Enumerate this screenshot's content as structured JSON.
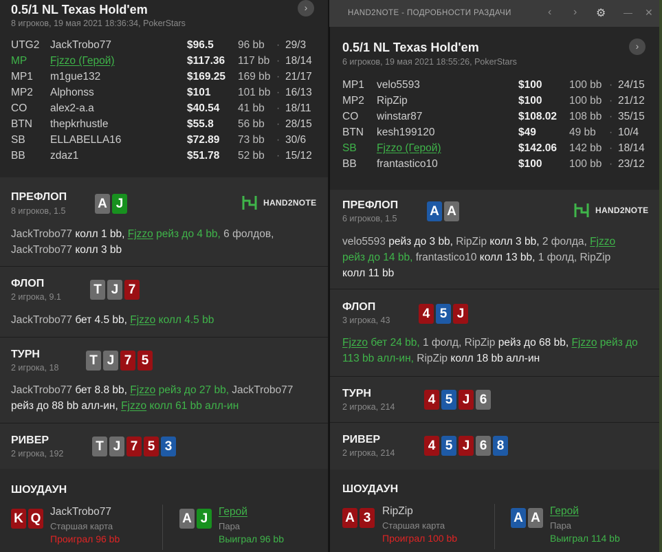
{
  "left": {
    "header": {
      "title": "0.5/1 NL Texas Hold'em",
      "subtitle": "8 игроков, 19 мая 2021 18:36:34, PokerStars",
      "nav": "›"
    },
    "players": [
      {
        "pos": "UTG2",
        "name": "JackTrobo77",
        "money": "$96.5",
        "bb": "96 bb",
        "dot": "·",
        "vpip": "29/3",
        "hero": false
      },
      {
        "pos": "MP",
        "name": "Fjzzo (Герой)",
        "money": "$117.36",
        "bb": "117 bb",
        "dot": "·",
        "vpip": "18/14",
        "hero": true
      },
      {
        "pos": "MP1",
        "name": "m1gue132",
        "money": "$169.25",
        "bb": "169 bb",
        "dot": "·",
        "vpip": "21/17",
        "hero": false
      },
      {
        "pos": "MP2",
        "name": "Alphonss",
        "money": "$101",
        "bb": "101 bb",
        "dot": "·",
        "vpip": "16/13",
        "hero": false
      },
      {
        "pos": "CO",
        "name": "alex2-a.a",
        "money": "$40.54",
        "bb": "41 bb",
        "dot": "·",
        "vpip": "18/11",
        "hero": false
      },
      {
        "pos": "BTN",
        "name": "thepkrhustle",
        "money": "$55.8",
        "bb": "56 bb",
        "dot": "·",
        "vpip": "28/15",
        "hero": false
      },
      {
        "pos": "SB",
        "name": "ELLABELLA16",
        "money": "$72.89",
        "bb": "73 bb",
        "dot": "·",
        "vpip": "30/6",
        "hero": false
      },
      {
        "pos": "BB",
        "name": "zdaz1",
        "money": "$51.78",
        "bb": "52 bb",
        "dot": "·",
        "vpip": "15/12",
        "hero": false
      }
    ],
    "preflop": {
      "title": "ПРЕФЛОП",
      "sub": "8 игроков, 1.5",
      "cards": [
        {
          "r": "A",
          "c": "gray"
        },
        {
          "r": "J",
          "c": "green"
        }
      ],
      "logo": "HAND2NOTE"
    },
    "preflop_action": {
      "l1a": "JackTrobo77",
      "l1b": " колл 1 bb, ",
      "l1c": "Fjzzo",
      "l1d": " рейз до 4 bb,",
      "l1e": " 6 фолдов,",
      "l2a": "JackTrobo77",
      "l2b": " колл 3 bb"
    },
    "flop": {
      "title": "ФЛОП",
      "sub": "2 игрока, 9.1",
      "cards": [
        {
          "r": "T",
          "c": "gray"
        },
        {
          "r": "J",
          "c": "gray"
        },
        {
          "r": "7",
          "c": "red"
        }
      ]
    },
    "flop_action": {
      "a": "JackTrobo77",
      "b": " бет 4.5 bb, ",
      "c": "Fjzzo",
      "d": " колл 4.5 bb"
    },
    "turn": {
      "title": "ТУРН",
      "sub": "2 игрока, 18",
      "cards": [
        {
          "r": "T",
          "c": "gray"
        },
        {
          "r": "J",
          "c": "gray"
        },
        {
          "r": "7",
          "c": "red"
        },
        {
          "r": "5",
          "c": "red"
        }
      ]
    },
    "turn_action": {
      "l1a": "JackTrobo77",
      "l1b": " бет 8.8 bb, ",
      "l1c": "Fjzzo",
      "l1d": " рейз до 27 bb,",
      "l1e": " JackTrobo77",
      "l2a": "рейз до 88 bb алл-ин, ",
      "l2b": "Fjzzo",
      "l2c": " колл 61 bb алл-ин"
    },
    "river": {
      "title": "РИВЕР",
      "sub": "2 игрока, 192",
      "cards": [
        {
          "r": "T",
          "c": "gray"
        },
        {
          "r": "J",
          "c": "gray"
        },
        {
          "r": "7",
          "c": "red"
        },
        {
          "r": "5",
          "c": "red"
        },
        {
          "r": "3",
          "c": "blue"
        }
      ]
    },
    "showdown": {
      "title": "ШОУДАУН",
      "p1": {
        "cards": [
          {
            "r": "K",
            "c": "red"
          },
          {
            "r": "Q",
            "c": "red"
          }
        ],
        "name": "JackTrobo77",
        "hand": "Старшая карта",
        "result": "Проиграл 96 bb"
      },
      "p2": {
        "cards": [
          {
            "r": "A",
            "c": "gray"
          },
          {
            "r": "J",
            "c": "green"
          }
        ],
        "name": "Герой",
        "hand": "Пара",
        "result": "Выиграл 96 bb"
      }
    }
  },
  "right": {
    "titlebar": {
      "title": "HAND2NOTE - ПОДРОБНОСТИ РАЗДАЧИ",
      "prev": "‹",
      "next": "›",
      "gear": "⚙",
      "min": "—",
      "close": "✕"
    },
    "header": {
      "title": "0.5/1 NL Texas Hold'em",
      "subtitle": "6 игроков, 19 мая 2021 18:55:26, PokerStars",
      "nav": "›"
    },
    "players": [
      {
        "pos": "MP1",
        "name": "velo5593",
        "money": "$100",
        "bb": "100 bb",
        "dot": "·",
        "vpip": "24/15",
        "hero": false
      },
      {
        "pos": "MP2",
        "name": "RipZip",
        "money": "$100",
        "bb": "100 bb",
        "dot": "·",
        "vpip": "21/12",
        "hero": false
      },
      {
        "pos": "CO",
        "name": "winstar87",
        "money": "$108.02",
        "bb": "108 bb",
        "dot": "·",
        "vpip": "35/15",
        "hero": false
      },
      {
        "pos": "BTN",
        "name": "kesh199120",
        "money": "$49",
        "bb": "49 bb",
        "dot": "·",
        "vpip": "10/4",
        "hero": false
      },
      {
        "pos": "SB",
        "name": "Fjzzo (Герой)",
        "money": "$142.06",
        "bb": "142 bb",
        "dot": "·",
        "vpip": "18/14",
        "hero": true
      },
      {
        "pos": "BB",
        "name": "frantastico10",
        "money": "$100",
        "bb": "100 bb",
        "dot": "·",
        "vpip": "23/12",
        "hero": false
      }
    ],
    "preflop": {
      "title": "ПРЕФЛОП",
      "sub": "6 игроков, 1.5",
      "cards": [
        {
          "r": "A",
          "c": "blue"
        },
        {
          "r": "A",
          "c": "gray"
        }
      ],
      "logo": "HAND2NOTE"
    },
    "preflop_action": {
      "l1a": "velo5593",
      "l1b": " рейз до 3 bb, ",
      "l1c": "RipZip",
      "l1d": " колл 3 bb, ",
      "l1e": "2 фолда, ",
      "l1f": "Fjzzo",
      "l2a": "рейз до 14 bb, ",
      "l2b": "frantastico10",
      "l2c": " колл 13 bb, ",
      "l2d": "1 фолд, ",
      "l2e": "RipZip",
      "l3a": "колл 11 bb"
    },
    "flop": {
      "title": "ФЛОП",
      "sub": "3 игрока, 43",
      "cards": [
        {
          "r": "4",
          "c": "red"
        },
        {
          "r": "5",
          "c": "blue"
        },
        {
          "r": "J",
          "c": "red"
        }
      ]
    },
    "flop_action": {
      "l1a": "Fjzzo",
      "l1b": " бет 24 bb, ",
      "l1c": "1 фолд, ",
      "l1d": "RipZip",
      "l1e": " рейз до 68 bb, ",
      "l1f": "Fjzzo",
      "l1g": " рейз до",
      "l2a": "113 bb алл-ин, ",
      "l2b": "RipZip",
      "l2c": " колл 18 bb алл-ин"
    },
    "turn": {
      "title": "ТУРН",
      "sub": "2 игрока, 214",
      "cards": [
        {
          "r": "4",
          "c": "red"
        },
        {
          "r": "5",
          "c": "blue"
        },
        {
          "r": "J",
          "c": "red"
        },
        {
          "r": "6",
          "c": "gray"
        }
      ]
    },
    "river": {
      "title": "РИВЕР",
      "sub": "2 игрока, 214",
      "cards": [
        {
          "r": "4",
          "c": "red"
        },
        {
          "r": "5",
          "c": "blue"
        },
        {
          "r": "J",
          "c": "red"
        },
        {
          "r": "6",
          "c": "gray"
        },
        {
          "r": "8",
          "c": "blue"
        }
      ]
    },
    "showdown": {
      "title": "ШОУДАУН",
      "p1": {
        "cards": [
          {
            "r": "A",
            "c": "red"
          },
          {
            "r": "3",
            "c": "red"
          }
        ],
        "name": "RipZip",
        "hand": "Старшая карта",
        "result": "Проиграл 100 bb"
      },
      "p2": {
        "cards": [
          {
            "r": "A",
            "c": "blue"
          },
          {
            "r": "A",
            "c": "gray"
          }
        ],
        "name": "Герой",
        "hand": "Пара",
        "result": "Выиграл 114 bb"
      }
    }
  },
  "colors": {
    "hero": "#3fb54a",
    "lost": "#e02424",
    "card_red": "#9b1014",
    "card_blue": "#1e5aa6",
    "card_gray": "#6c6c6c",
    "card_green": "#18911f"
  }
}
